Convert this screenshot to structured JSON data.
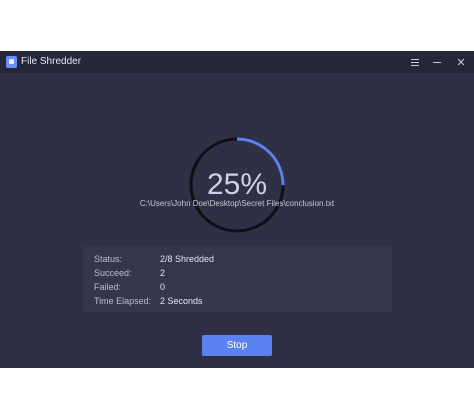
{
  "window": {
    "title": "File Shredder"
  },
  "progress": {
    "percent_label": "25%",
    "fraction": 0.25
  },
  "file_path": "C:\\Users\\John Doe\\Desktop\\Secret Files\\conclusion.txt",
  "stats": [
    {
      "label": "Status:",
      "value": "2/8 Shredded"
    },
    {
      "label": "Succeed:",
      "value": "2"
    },
    {
      "label": "Failed:",
      "value": "0"
    },
    {
      "label": "Time Elapsed:",
      "value": "2 Seconds"
    }
  ],
  "actions": {
    "stop_label": "Stop"
  },
  "colors": {
    "background": "#2f2f45",
    "titlebar": "#26263a",
    "ring_track": "#0f0f18",
    "ring_progress": "#5b82f0",
    "accent": "#5b82f0",
    "panel": "#35354e"
  }
}
